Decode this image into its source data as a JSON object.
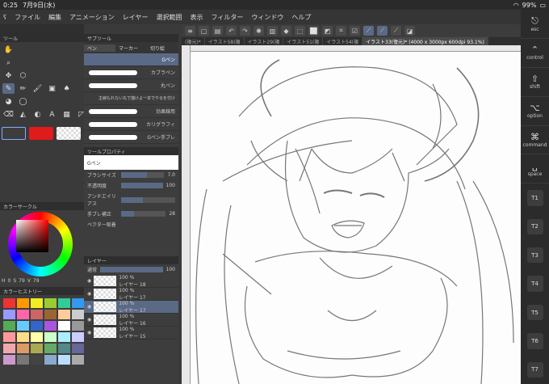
{
  "status": {
    "time": "0:25",
    "date": "7月9日(水)",
    "battery": "99%"
  },
  "menu": [
    "ファイル",
    "編集",
    "アニメーション",
    "レイヤー",
    "選択範囲",
    "表示",
    "フィルター",
    "ウィンドウ",
    "ヘルプ"
  ],
  "tabs": [
    "(複元)*",
    "イラスト58(複",
    "イラスト29(複",
    "イラスト51(複",
    "イラスト54(複",
    "イラスト33(復元)* (4000 x 3000px 600dpi 93.1%)"
  ],
  "panels": {
    "tool": "ツール",
    "subtool": "サブツール",
    "toolprop": "ツールプロパティ",
    "colorcircle": "カラーサークル",
    "history": "カラーヒストリー",
    "layer": "レイヤー"
  },
  "subtool_tabs": [
    "ペン",
    "マーカー",
    "切り絵"
  ],
  "brushes": [
    "Gペン",
    "カブラペン",
    "丸ペン",
    "主線もれない丸で描けよ一本でやるを付け",
    "効果線用",
    "カリグラフィ",
    "Gペン手ブレ"
  ],
  "toolprop": {
    "brush_name": "Gペン",
    "size_label": "ブラシサイズ",
    "size_value": "7.0",
    "opacity_label": "不透明度",
    "opacity_value": "100",
    "aa_label": "アンチエイリアス",
    "stab_label": "手ブレ補正",
    "stab_value": "28",
    "vector_label": "ベクター吸着"
  },
  "color": {
    "h": "0",
    "s": "79",
    "v": "79",
    "main": "#e01b1b"
  },
  "layer": {
    "blend": "通常",
    "opacity": "100"
  },
  "layers": [
    {
      "opacity": "100 %",
      "name": "レイヤー 18"
    },
    {
      "opacity": "100 %",
      "name": "レイヤー 17"
    },
    {
      "opacity": "100 %",
      "name": "レイヤー 17"
    },
    {
      "opacity": "100 %",
      "name": "レイヤー 16"
    },
    {
      "opacity": "100 %",
      "name": "レイヤー 15"
    }
  ],
  "right_keys": [
    {
      "icon": "⎋",
      "label": "esc"
    },
    {
      "icon": "⌃",
      "label": "control"
    },
    {
      "icon": "⇧",
      "label": "shift"
    },
    {
      "icon": "⌥",
      "label": "option"
    },
    {
      "icon": "⌘",
      "label": "command"
    },
    {
      "icon": "␣",
      "label": "space"
    }
  ],
  "tkeys": [
    "T1",
    "T2",
    "T3",
    "T4",
    "T5",
    "T6",
    "T7"
  ],
  "history_colors": [
    "#e33",
    "#f90",
    "#ee2",
    "#9c3",
    "#3c9",
    "#39e",
    "#99f",
    "#f6a",
    "#c66",
    "#963",
    "#fc9",
    "#ccc",
    "#5a5",
    "#6cf",
    "#36c",
    "#a5d",
    "#fff",
    "#999",
    "#f99",
    "#fd8",
    "#ffa",
    "#cfc",
    "#aef",
    "#ccf",
    "#eaa",
    "#d96",
    "#aa5",
    "#6a6",
    "#588",
    "#669",
    "#c9c",
    "#777",
    "#444",
    "#8ac",
    "#bdf",
    "#aaa"
  ]
}
